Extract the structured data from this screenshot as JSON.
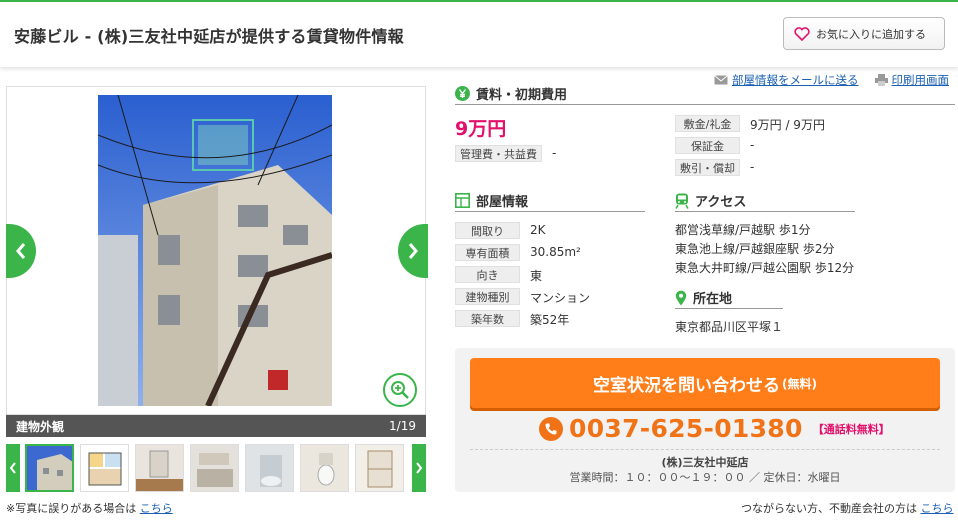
{
  "header": {
    "title": "安藤ビル - (株)三友社中延店が提供する賃貸物件情報",
    "favorite_label": "お気に入りに追加する"
  },
  "gallery": {
    "caption": "建物外観",
    "counter": "1/19",
    "note": "※写真に誤りがある場合は",
    "note_link": "こちら"
  },
  "toplinks": {
    "mail": "部屋情報をメールに送る",
    "print": "印刷用画面"
  },
  "rent_section": {
    "heading": "賃料・初期費用",
    "rent": "9万円",
    "mgmt_label": "管理費・共益費",
    "mgmt_value": "-",
    "rows": [
      {
        "label": "敷金/礼金",
        "value": "9万円 / 9万円"
      },
      {
        "label": "保証金",
        "value": "-"
      },
      {
        "label": "敷引・償却",
        "value": "-"
      }
    ]
  },
  "room_section": {
    "heading": "部屋情報",
    "rows": [
      {
        "label": "間取り",
        "value": "2K"
      },
      {
        "label": "専有面積",
        "value": "30.85m²"
      },
      {
        "label": "向き",
        "value": "東"
      },
      {
        "label": "建物種別",
        "value": "マンション"
      },
      {
        "label": "築年数",
        "value": "築52年"
      }
    ]
  },
  "access_section": {
    "heading": "アクセス",
    "lines": [
      "都営浅草線/戸越駅 歩1分",
      "東急池上線/戸越銀座駅 歩2分",
      "東急大井町線/戸越公園駅 歩12分"
    ]
  },
  "location_section": {
    "heading": "所在地",
    "address": "東京都品川区平塚１"
  },
  "contact": {
    "cta_label": "空室状況を問い合わせる",
    "cta_suffix": "(無料)",
    "phone": "0037-625-01380",
    "phone_note": "【通話料無料】",
    "shop": "(株)三友社中延店",
    "hours": "営業時間：１０：００～１９：００ ／ 定休日：水曜日",
    "note": "つながらない方、不動産会社の方は",
    "note_link": "こちら"
  },
  "colors": {
    "brand_green": "#3bb54a",
    "price_pink": "#e3106b",
    "cta_orange": "#ff7e1a"
  },
  "icons": [
    "heart-icon",
    "mail-icon",
    "print-icon",
    "yen-icon",
    "room-icon",
    "train-icon",
    "pin-icon",
    "phone-icon",
    "zoom-icon",
    "chevron-left-icon",
    "chevron-right-icon"
  ]
}
